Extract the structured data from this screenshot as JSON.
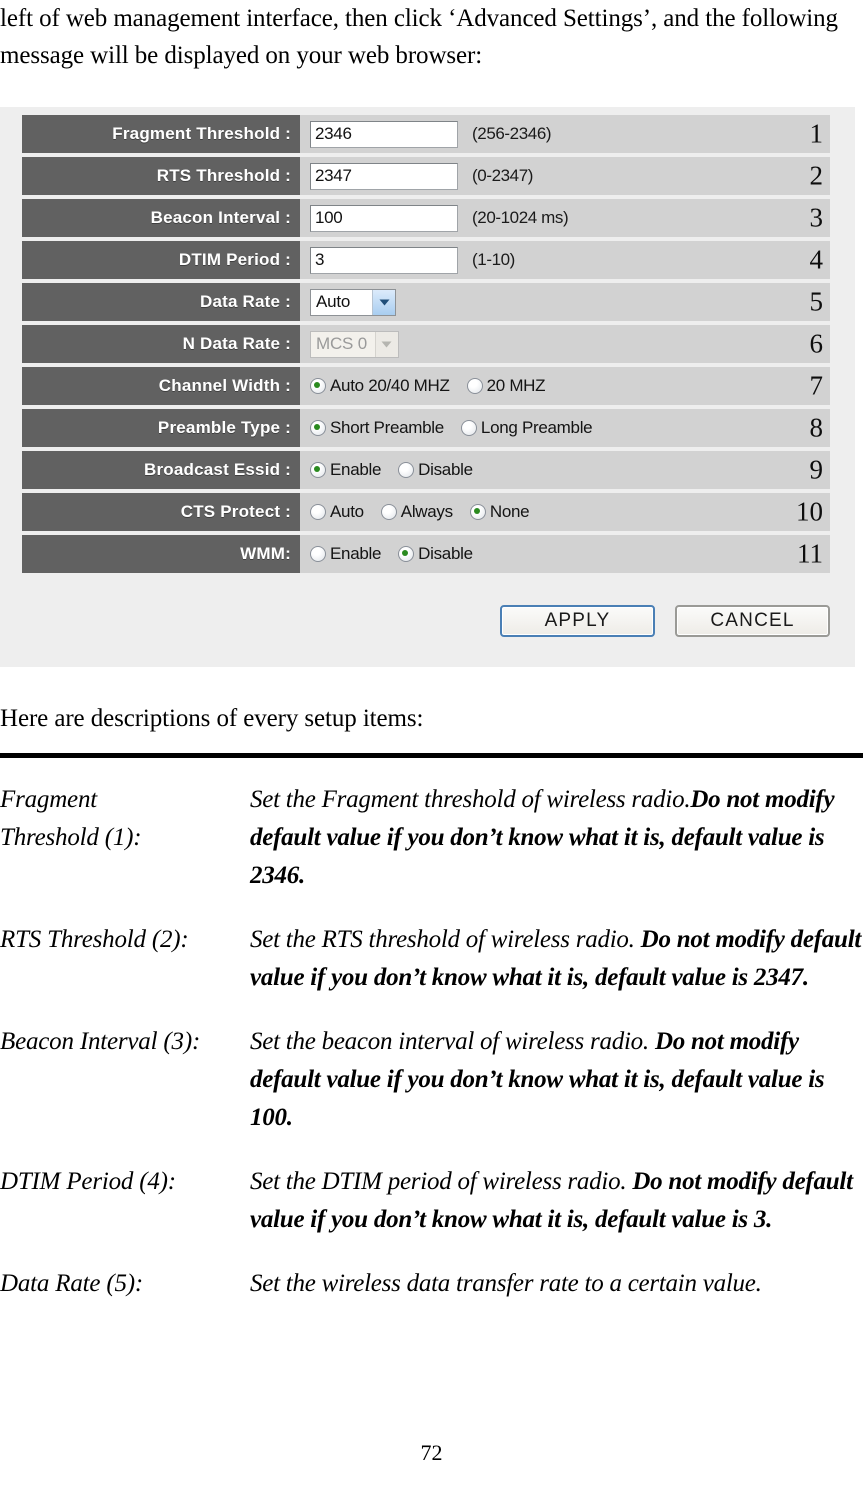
{
  "intro": {
    "text": "left of web management interface, then click ‘Advanced Settings’, and the following message will be displayed on your web browser:"
  },
  "panel": {
    "rows": [
      {
        "num": "1",
        "label": "Fragment Threshold :",
        "control": "text",
        "value": "2346",
        "hint": "(256-2346)"
      },
      {
        "num": "2",
        "label": "RTS Threshold :",
        "control": "text",
        "value": "2347",
        "hint": "(0-2347)"
      },
      {
        "num": "3",
        "label": "Beacon Interval :",
        "control": "text",
        "value": "100",
        "hint": "(20-1024 ms)"
      },
      {
        "num": "4",
        "label": "DTIM Period :",
        "control": "text",
        "value": "3",
        "hint": "(1-10)"
      },
      {
        "num": "5",
        "label": "Data Rate :",
        "control": "select",
        "value": "Auto",
        "disabled": false
      },
      {
        "num": "6",
        "label": "N Data Rate :",
        "control": "select",
        "value": "MCS 0",
        "disabled": true
      },
      {
        "num": "7",
        "label": "Channel Width :",
        "control": "radio",
        "options": [
          {
            "label": "Auto 20/40 MHZ",
            "selected": true
          },
          {
            "label": "20 MHZ",
            "selected": false
          }
        ]
      },
      {
        "num": "8",
        "label": "Preamble Type :",
        "control": "radio",
        "options": [
          {
            "label": "Short Preamble",
            "selected": true
          },
          {
            "label": "Long Preamble",
            "selected": false
          }
        ]
      },
      {
        "num": "9",
        "label": "Broadcast Essid :",
        "control": "radio",
        "options": [
          {
            "label": "Enable",
            "selected": true
          },
          {
            "label": "Disable",
            "selected": false
          }
        ]
      },
      {
        "num": "10",
        "label": "CTS Protect :",
        "control": "radio",
        "options": [
          {
            "label": "Auto",
            "selected": false
          },
          {
            "label": "Always",
            "selected": false
          },
          {
            "label": "None",
            "selected": true
          }
        ]
      },
      {
        "num": "11",
        "label": "WMM:",
        "control": "radio",
        "options": [
          {
            "label": "Enable",
            "selected": false
          },
          {
            "label": "Disable",
            "selected": true
          }
        ]
      }
    ],
    "buttons": {
      "apply": "APPLY",
      "cancel": "CANCEL"
    }
  },
  "descriptions": {
    "lead": "Here are descriptions of every setup items:",
    "items": [
      {
        "term": "Fragment Threshold (1):",
        "term_lines": [
          "Fragment",
          "Threshold (1):"
        ],
        "plain": "Set the Fragment threshold of wireless radio.",
        "bold": "Do not modify default value if you don’t know what it is, default value is 2346."
      },
      {
        "term": "RTS Threshold (2):",
        "term_lines": [
          "RTS Threshold (2):"
        ],
        "plain": "Set the RTS threshold of wireless radio. ",
        "bold": "Do not modify default value if you don’t know what it is, default value is 2347."
      },
      {
        "term": "Beacon Interval (3):",
        "term_lines": [
          "Beacon Interval (3):"
        ],
        "plain": "Set the beacon interval of wireless radio. ",
        "bold": "Do not modify default value if you don’t know what it is, default value is 100."
      },
      {
        "term": "DTIM Period (4):",
        "term_lines": [
          "DTIM Period (4):"
        ],
        "plain": "Set the DTIM period of wireless radio. ",
        "bold": "Do not modify default value if you don’t know what it is, default value is 3."
      },
      {
        "term": "Data Rate (5):",
        "term_lines": [
          "Data Rate (5):"
        ],
        "plain": "Set the wireless data transfer rate to a certain value.",
        "bold": ""
      }
    ]
  },
  "page_number": "72",
  "colors": {
    "label_bg": "#616161",
    "field_bg": "#d2d2d2",
    "panel_bg": "#eeeeee",
    "radio_selected": "#2a8a1f",
    "primary_border": "#4a7fb5"
  }
}
